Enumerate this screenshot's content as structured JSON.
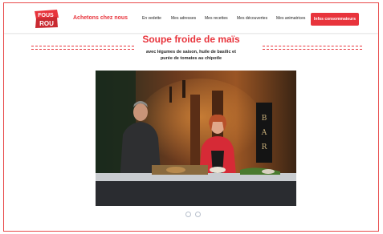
{
  "header": {
    "logo_line1": "FOUS",
    "logo_line2": "ROU",
    "achetons": "Achetons chez nous",
    "nav": [
      "En vedette",
      "Mes adresses",
      "Mes recettes",
      "Mes découvertes",
      "Mes animatrices"
    ],
    "cta": "Infos consommateurs"
  },
  "recipe": {
    "title": "Soupe froide de maïs",
    "subtitle_line1": "avec légumes de saison, huile de basilic et",
    "subtitle_line2": "purée de tomates au chipotle",
    "sign_letters": [
      "B",
      "A",
      "R"
    ]
  },
  "carousel": {
    "slides": 2,
    "active_index": 0
  },
  "colors": {
    "brand_red": "#e8343c",
    "dot_border": "#b8c0cc"
  }
}
